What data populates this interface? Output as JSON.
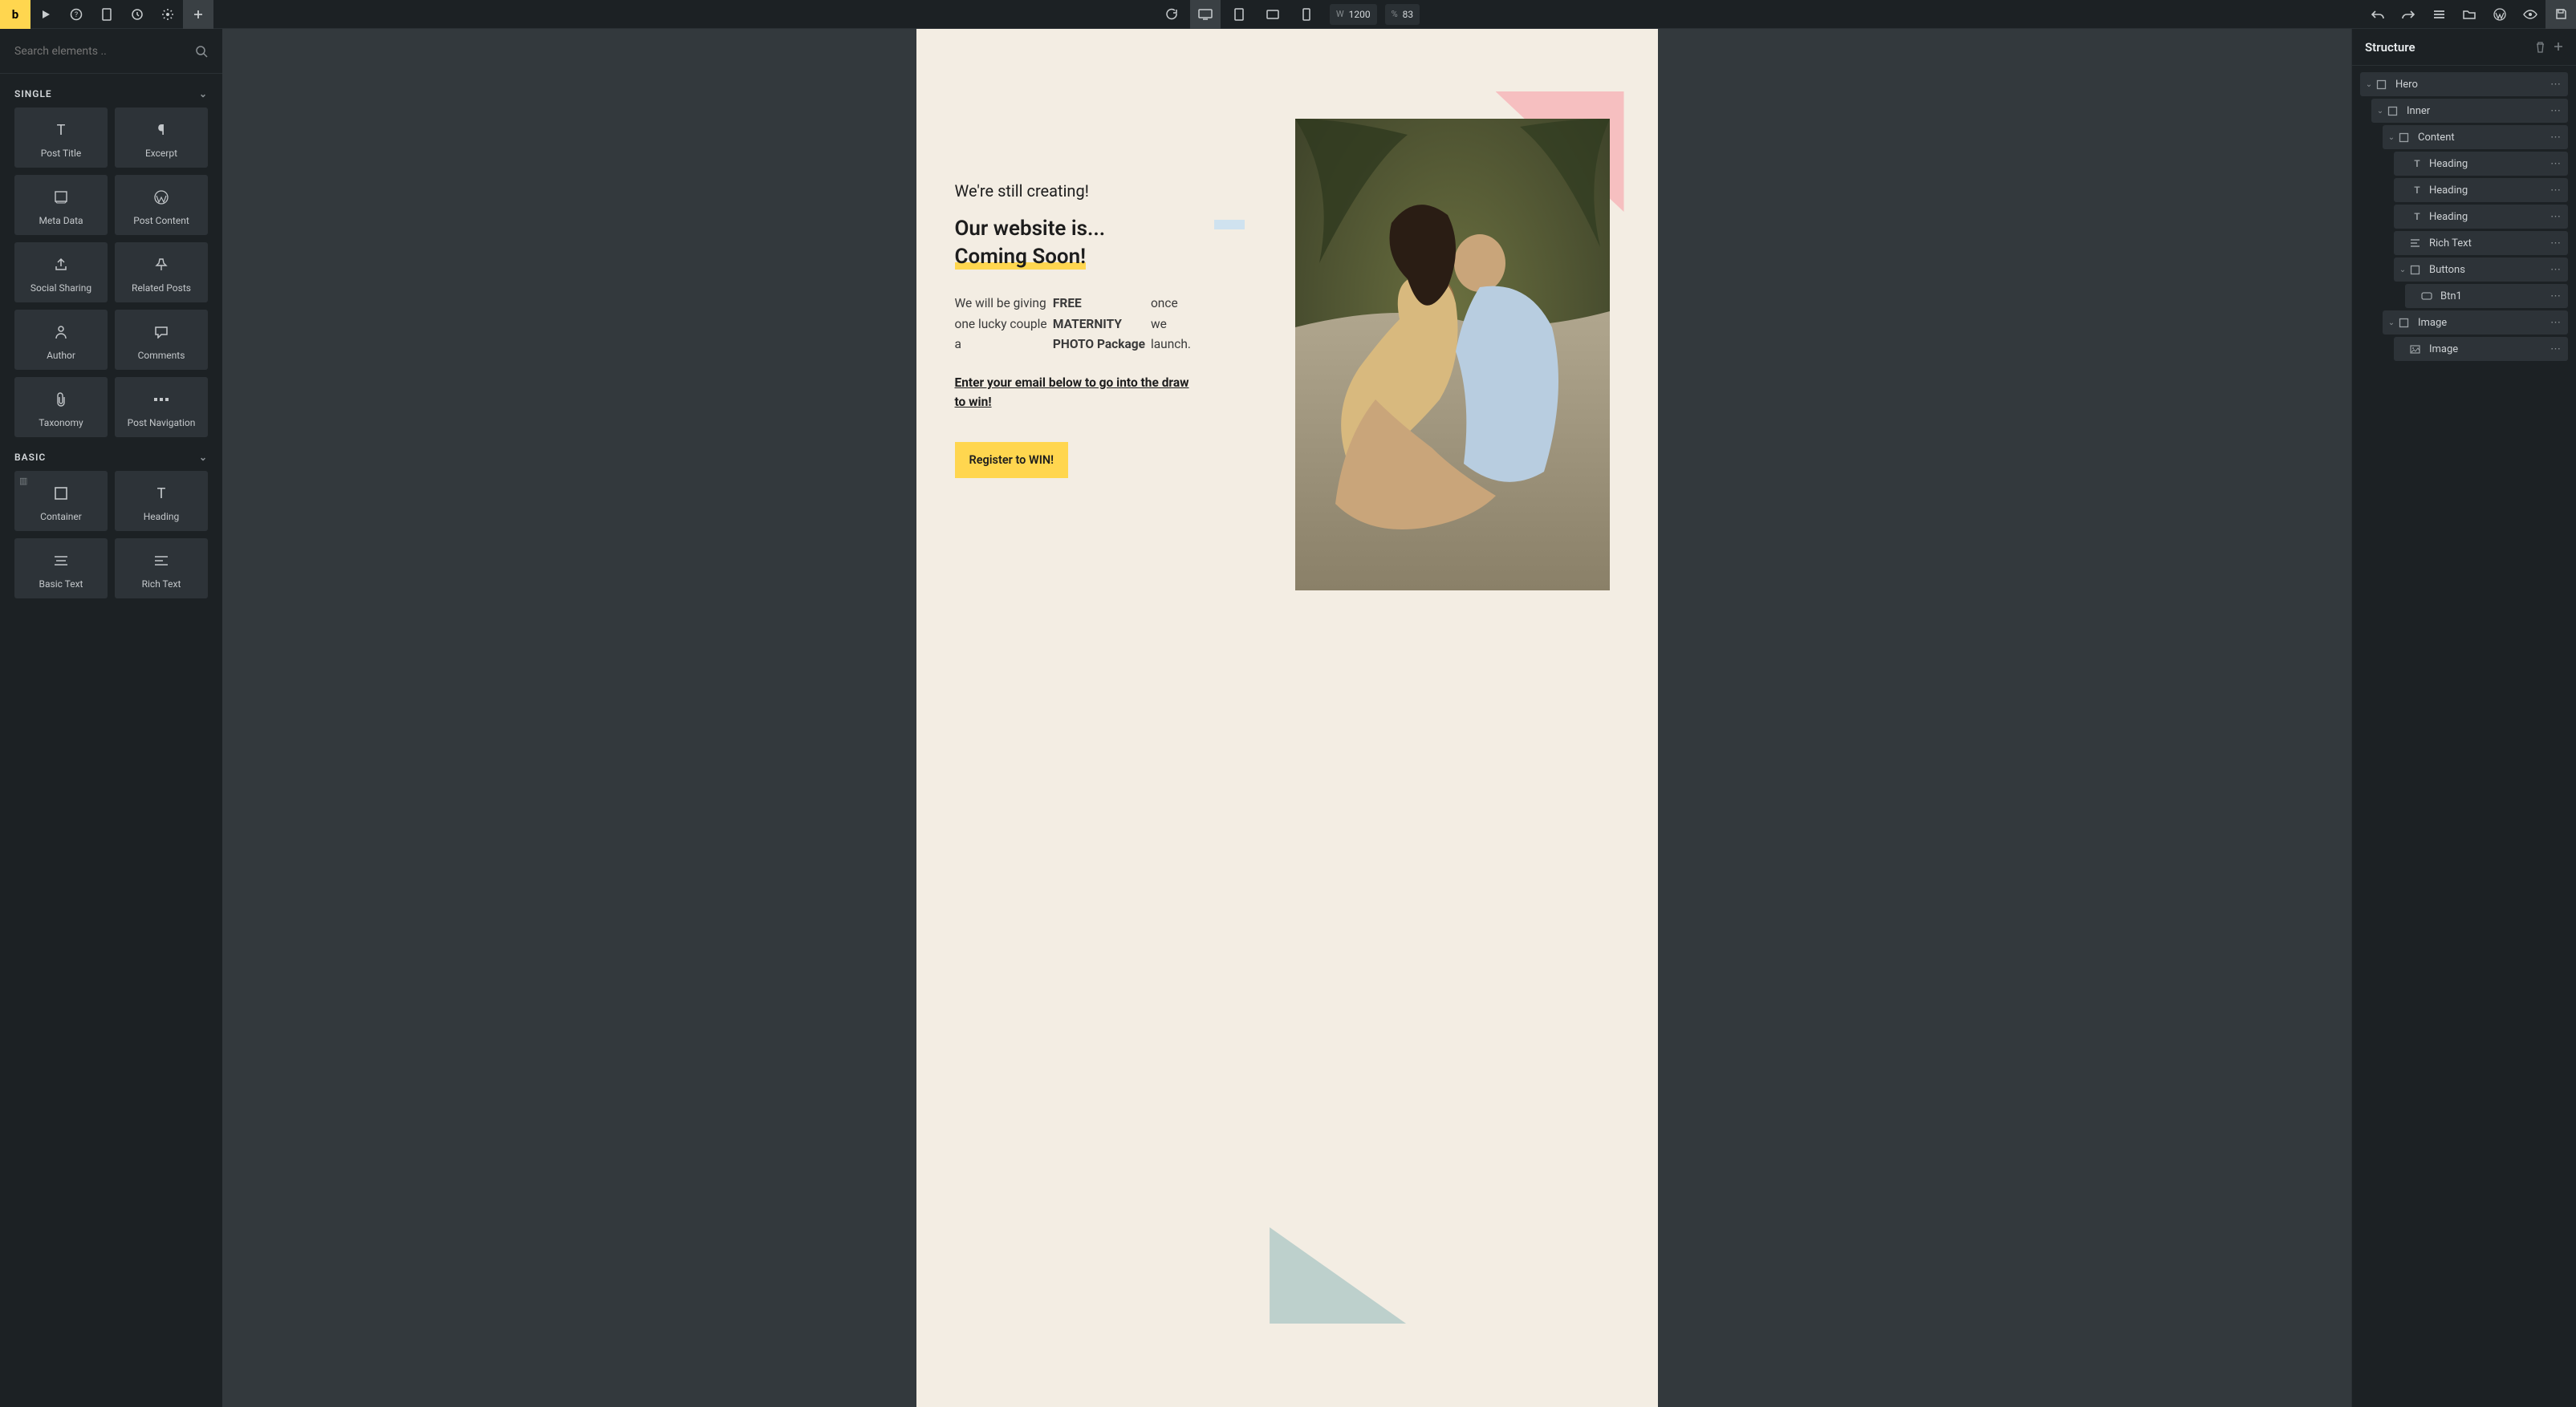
{
  "topbar": {
    "logo": "b",
    "width_prefix": "W",
    "width_value": "1200",
    "percent_prefix": "%",
    "percent_value": "83"
  },
  "search": {
    "placeholder": "Search elements .."
  },
  "categories": {
    "single": {
      "title": "SINGLE",
      "items": [
        {
          "label": "Post Title"
        },
        {
          "label": "Excerpt"
        },
        {
          "label": "Meta Data"
        },
        {
          "label": "Post Content"
        },
        {
          "label": "Social Sharing"
        },
        {
          "label": "Related Posts"
        },
        {
          "label": "Author"
        },
        {
          "label": "Comments"
        },
        {
          "label": "Taxonomy"
        },
        {
          "label": "Post Navigation"
        }
      ]
    },
    "basic": {
      "title": "BASIC",
      "items": [
        {
          "label": "Container"
        },
        {
          "label": "Heading"
        },
        {
          "label": "Basic Text"
        },
        {
          "label": "Rich Text"
        }
      ]
    }
  },
  "canvas": {
    "eyebrow": "We're still creating!",
    "title_line1": "Our website is...",
    "title_line2": "Coming Soon!",
    "body_pre": "We will be giving one lucky couple a ",
    "body_strong": "FREE MATERNITY PHOTO Package",
    "body_post": " once we launch.",
    "cta_text": "Enter your email below to go into the draw to win!",
    "button": "Register to WIN!"
  },
  "structure": {
    "title": "Structure",
    "nodes": [
      {
        "label": "Hero",
        "depth": 0,
        "icon": "sq",
        "exp": true
      },
      {
        "label": "Inner",
        "depth": 1,
        "icon": "sq",
        "exp": true
      },
      {
        "label": "Content",
        "depth": 2,
        "icon": "sq",
        "exp": true
      },
      {
        "label": "Heading",
        "depth": 3,
        "icon": "t",
        "exp": false
      },
      {
        "label": "Heading",
        "depth": 3,
        "icon": "t",
        "exp": false
      },
      {
        "label": "Heading",
        "depth": 3,
        "icon": "t",
        "exp": false
      },
      {
        "label": "Rich Text",
        "depth": 3,
        "icon": "p",
        "exp": false
      },
      {
        "label": "Buttons",
        "depth": 3,
        "icon": "sq",
        "exp": true
      },
      {
        "label": "Btn1",
        "depth": 4,
        "icon": "btn",
        "exp": false
      },
      {
        "label": "Image",
        "depth": 2,
        "icon": "sq",
        "exp": true
      },
      {
        "label": "Image",
        "depth": 3,
        "icon": "img",
        "exp": false
      }
    ]
  }
}
